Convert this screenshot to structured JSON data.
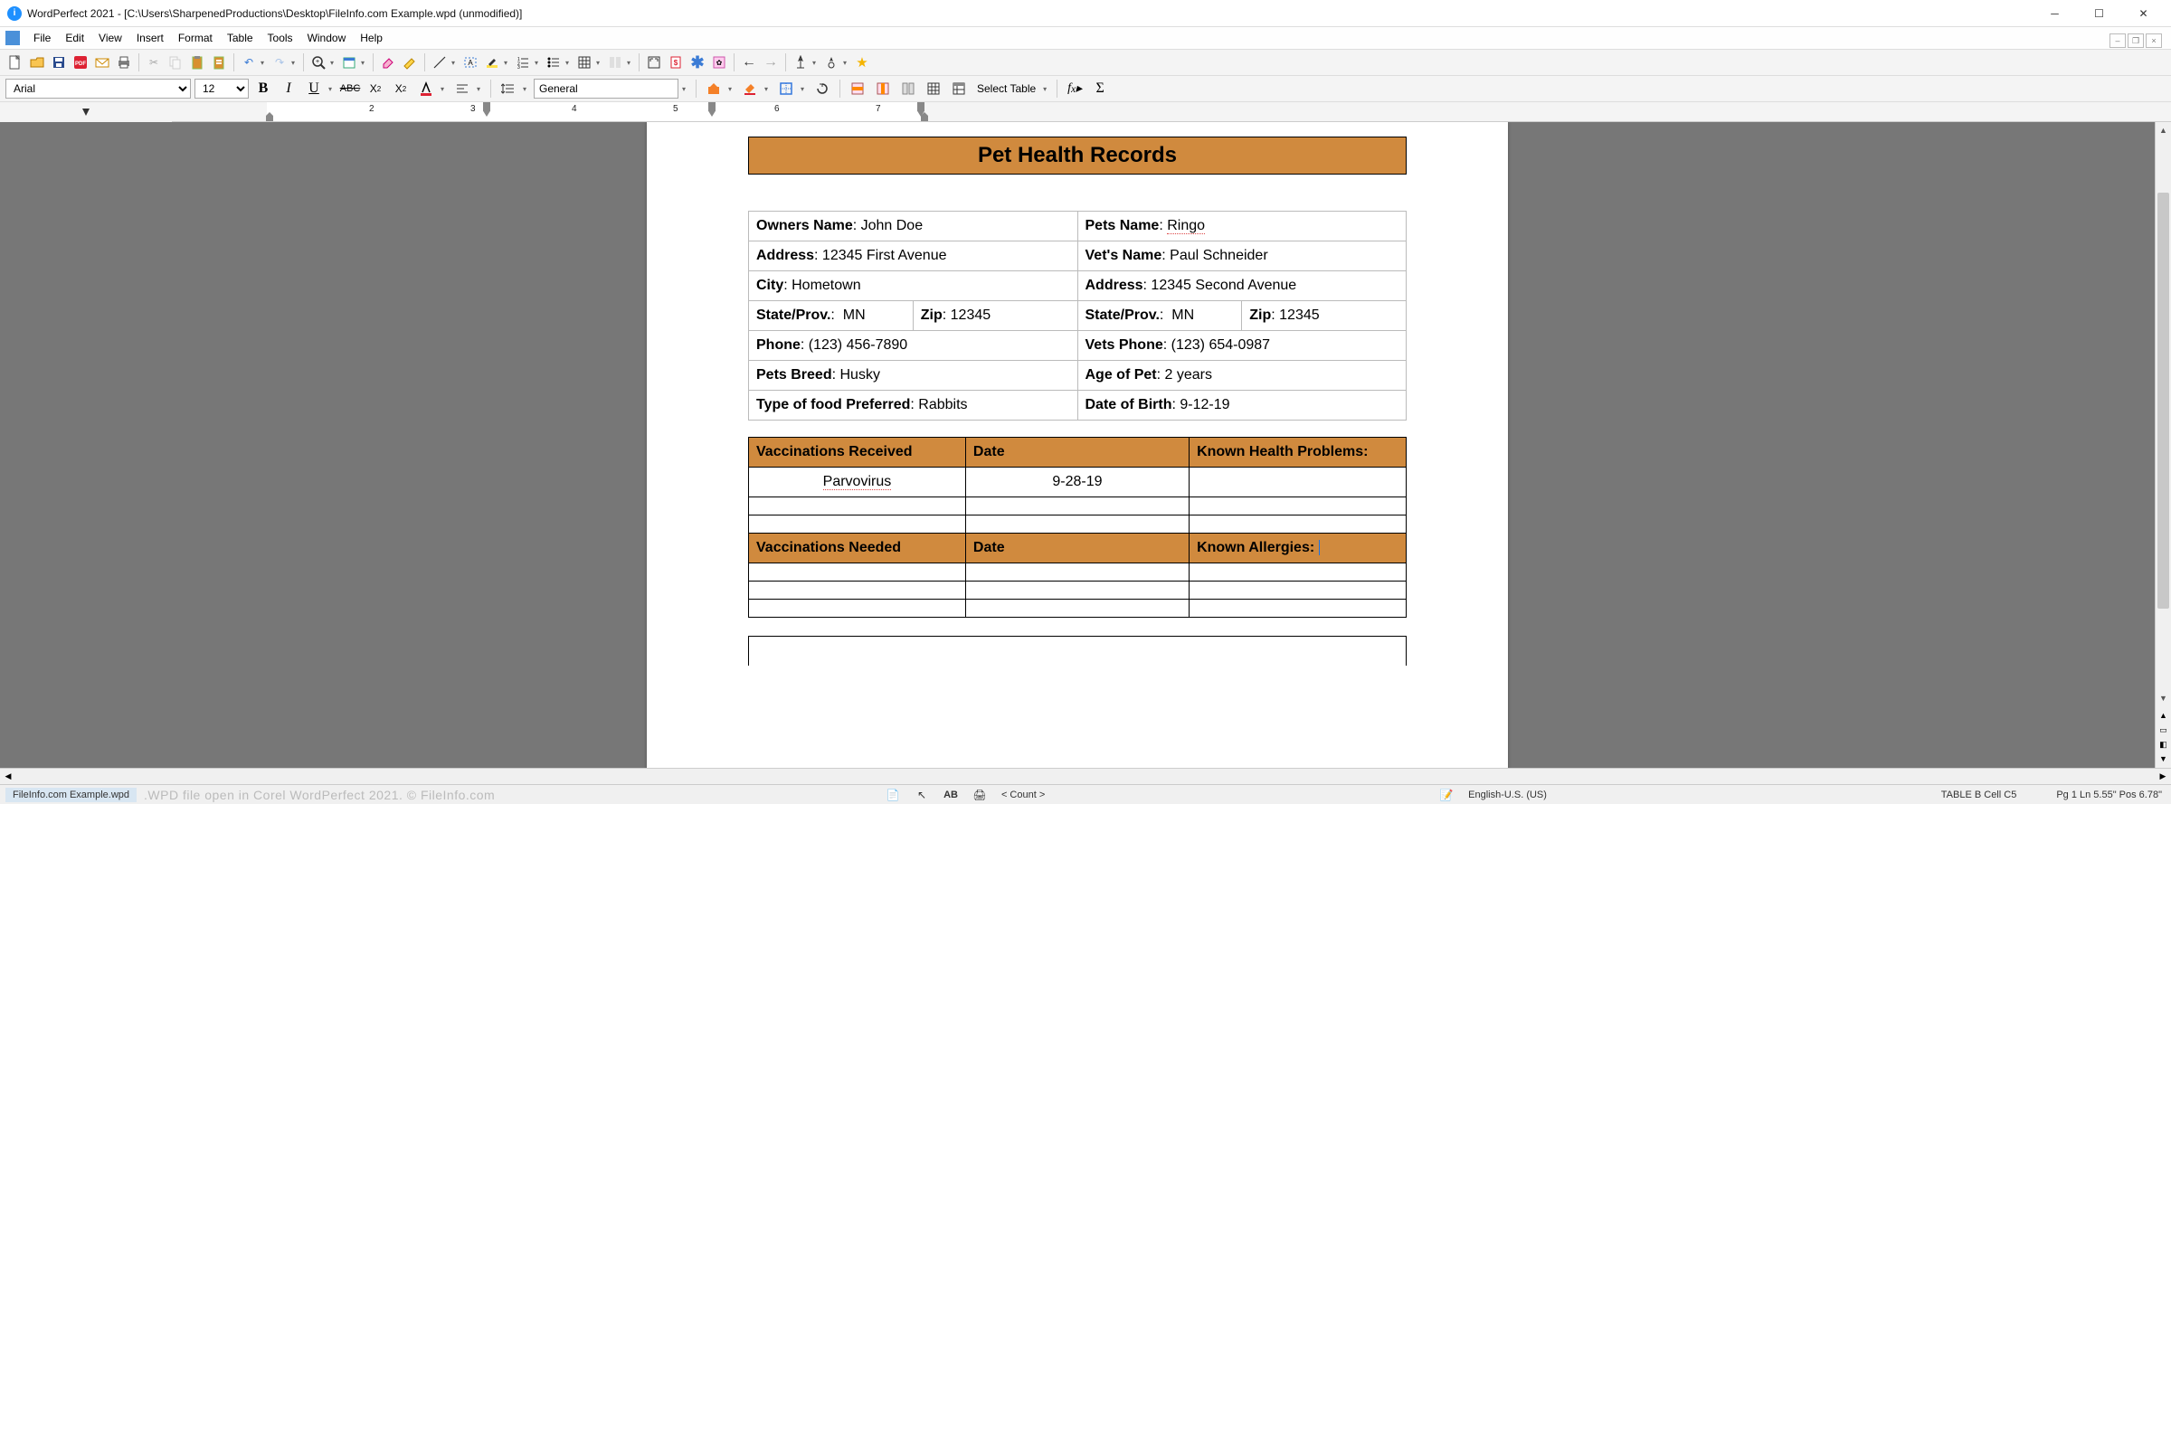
{
  "window": {
    "title": "WordPerfect 2021 - [C:\\Users\\SharpenedProductions\\Desktop\\FileInfo.com Example.wpd (unmodified)]"
  },
  "menus": [
    "File",
    "Edit",
    "View",
    "Insert",
    "Format",
    "Table",
    "Tools",
    "Window",
    "Help"
  ],
  "font": {
    "name": "Arial",
    "size": "12",
    "style_general": "General",
    "select_table": "Select Table"
  },
  "ruler_numbers": [
    "2",
    "3",
    "4",
    "5",
    "6",
    "7"
  ],
  "document": {
    "title": "Pet Health Records",
    "owner": {
      "name_label": "Owners Name",
      "name": "John Doe",
      "address_label": "Address",
      "address": "12345 First Avenue",
      "city_label": "City",
      "city": "Hometown",
      "state_label": "State/Prov.",
      "state": "MN",
      "zip_label": "Zip",
      "zip": "12345",
      "phone_label": "Phone",
      "phone": "(123) 456-7890",
      "breed_label": "Pets Breed",
      "breed": "Husky",
      "food_label": "Type of food Preferred",
      "food": "Rabbits"
    },
    "pet": {
      "name_label": "Pets Name",
      "name": "Ringo",
      "vet_label": "Vet's Name",
      "vet": "Paul Schneider",
      "address_label": "Address",
      "address": "12345 Second Avenue",
      "state_label": "State/Prov.",
      "state": "MN",
      "zip_label": "Zip",
      "zip": "12345",
      "phone_label": "Vets Phone",
      "phone": "(123) 654-0987",
      "age_label": "Age of Pet",
      "age": "2 years",
      "dob_label": "Date of Birth",
      "dob": "9-12-19"
    },
    "vacc_received": {
      "h1": "Vaccinations Received",
      "h2": "Date",
      "h3": "Known Health Problems:",
      "rows": [
        {
          "name": "Parvovirus",
          "date": "9-28-19",
          "problem": ""
        },
        {
          "name": "",
          "date": "",
          "problem": ""
        },
        {
          "name": "",
          "date": "",
          "problem": ""
        }
      ]
    },
    "vacc_needed": {
      "h1": "Vaccinations Needed",
      "h2": "Date",
      "h3": "Known Allergies:",
      "rows": [
        {
          "name": "",
          "date": "",
          "problem": ""
        },
        {
          "name": "",
          "date": "",
          "problem": ""
        },
        {
          "name": "",
          "date": "",
          "problem": ""
        }
      ]
    }
  },
  "status": {
    "filename": "FileInfo.com Example.wpd",
    "watermark": ".WPD file open in Corel WordPerfect 2021. © FileInfo.com",
    "count": "< Count >",
    "lang": "English-U.S. (US)",
    "table": "TABLE B Cell  C5",
    "pos": "Pg 1 Ln 5.55\" Pos 6.78\""
  }
}
